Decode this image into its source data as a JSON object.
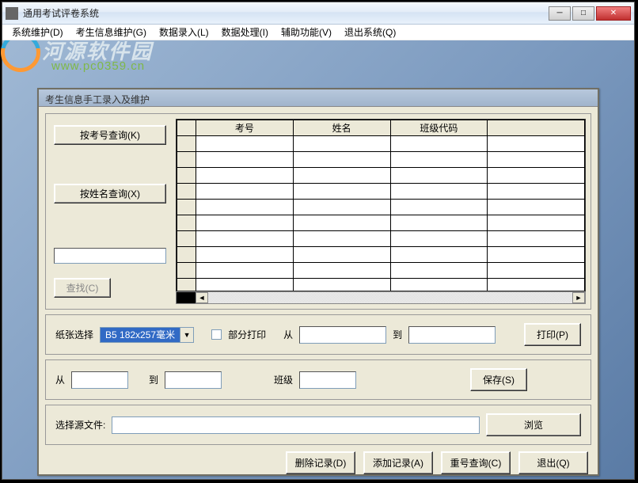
{
  "window": {
    "title": "通用考试评卷系统"
  },
  "menu": {
    "items": [
      "系统维护(D)",
      "考生信息维护(G)",
      "数据录入(L)",
      "数据处理(I)",
      "辅助功能(V)",
      "退出系统(Q)"
    ]
  },
  "watermark": {
    "text": "河源软件园",
    "url": "www.pc0359.cn"
  },
  "dialog": {
    "title": "考生信息手工录入及维护",
    "query_by_exam_no": "按考号查询(K)",
    "query_by_name": "按姓名查询(X)",
    "find": "查找(C)",
    "grid_headers": [
      "考号",
      "姓名",
      "班级代码",
      ""
    ],
    "paper_label": "纸张选择",
    "paper_value": "B5 182x257毫米",
    "partial_print": "部分打印",
    "from": "从",
    "to": "到",
    "print": "打印(P)",
    "class_label": "班级",
    "save": "保存(S)",
    "source_file_label": "选择源文件:",
    "browse": "浏览",
    "delete_record": "删除记录(D)",
    "add_record": "添加记录(A)",
    "dup_query": "重号查询(C)",
    "exit": "退出(Q)"
  }
}
